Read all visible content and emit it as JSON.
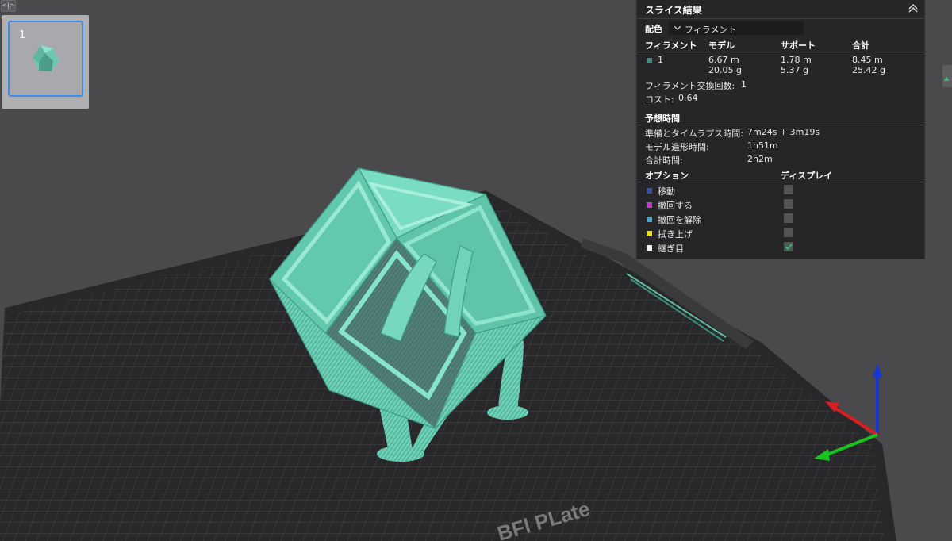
{
  "viewport": {
    "plate_label": "BFl PLate"
  },
  "plate_list": {
    "toggle_glyph": "<|>",
    "plates": [
      {
        "number": "1"
      }
    ]
  },
  "slice_panel": {
    "title": "スライス結果",
    "color_scheme": {
      "label": "配色",
      "value": "フィラメント"
    },
    "table_headers": {
      "filament": "フィラメント",
      "model": "モデル",
      "support": "サポート",
      "total": "合計"
    },
    "filaments": [
      {
        "id": "1",
        "color": "#3e8f7e",
        "model_length": "6.67 m",
        "model_weight": "20.05 g",
        "support_length": "1.78 m",
        "support_weight": "5.37 g",
        "total_length": "8.45 m",
        "total_weight": "25.42 g"
      }
    ],
    "filament_changes": {
      "label": "フィラメント交換回数:",
      "value": "1"
    },
    "cost": {
      "label": "コスト:",
      "value": "0.64"
    },
    "estimated_time": {
      "title": "予想時間",
      "rows": [
        {
          "label": "準備とタイムラプス時間:",
          "value": "7m24s + 3m19s"
        },
        {
          "label": "モデル造形時間:",
          "value": "1h51m"
        },
        {
          "label": "合計時間:",
          "value": "2h2m"
        }
      ]
    },
    "options": {
      "header_option": "オプション",
      "header_display": "ディスプレイ",
      "items": [
        {
          "label": "移動",
          "color": "#3a4fa8",
          "checked": false
        },
        {
          "label": "撤回する",
          "color": "#c43bd1",
          "checked": false
        },
        {
          "label": "撤回を解除",
          "color": "#4aa3c8",
          "checked": false
        },
        {
          "label": "拭き上げ",
          "color": "#e8e01a",
          "checked": false
        },
        {
          "label": "継ぎ目",
          "color": "#f0f0f0",
          "checked": true
        }
      ]
    }
  }
}
